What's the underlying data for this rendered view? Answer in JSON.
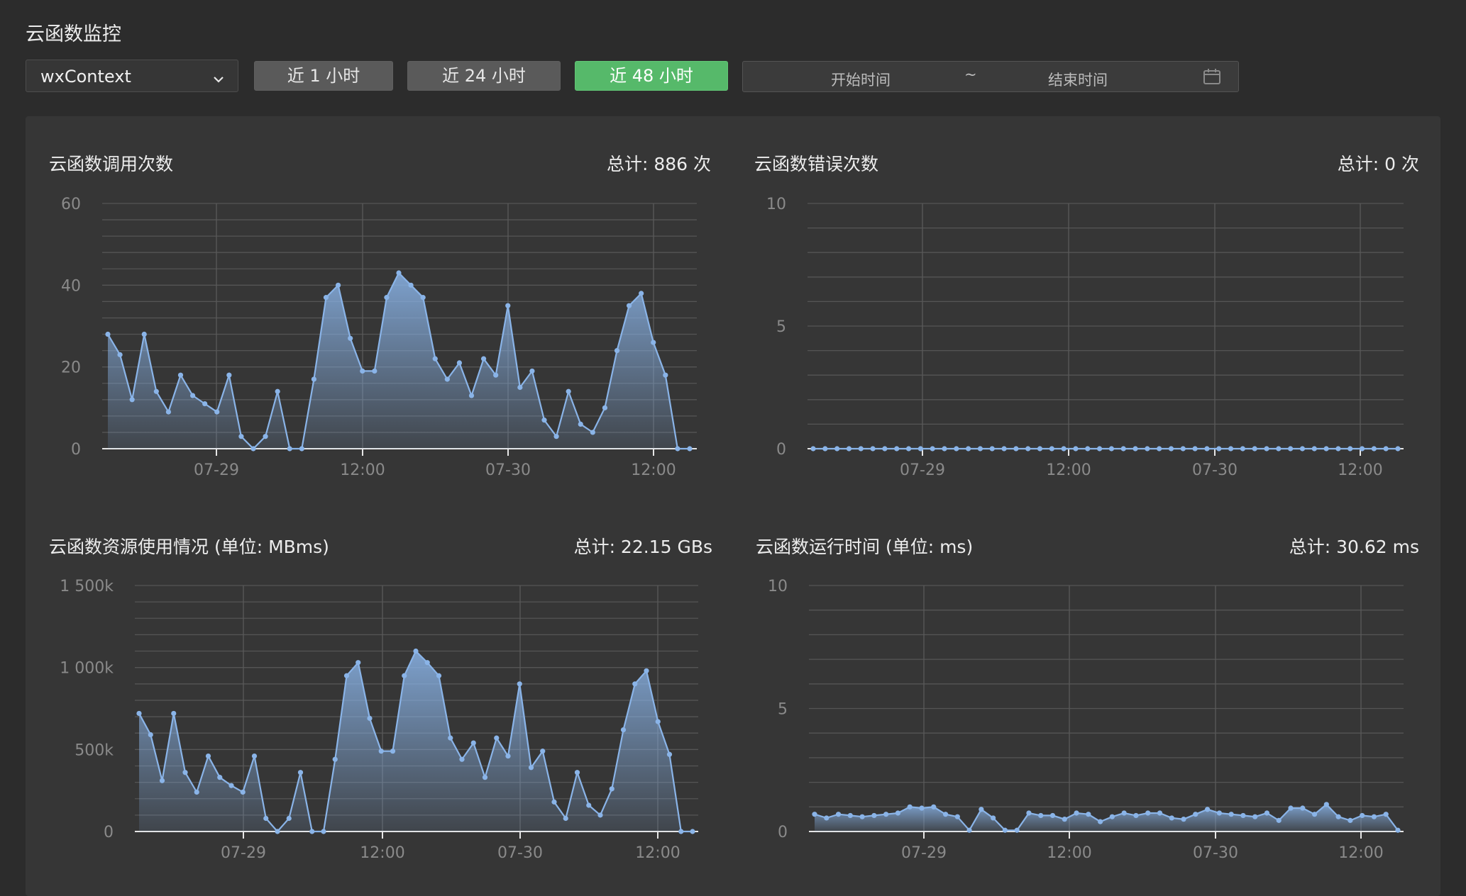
{
  "page": {
    "title": "云函数监控"
  },
  "filters": {
    "function_select": {
      "value": "wxContext"
    },
    "buttons": [
      {
        "label": "近 1 小时",
        "active": false
      },
      {
        "label": "近 24 小时",
        "active": false
      },
      {
        "label": "近 48 小时",
        "active": true
      }
    ],
    "date_range": {
      "start_placeholder": "开始时间",
      "separator": "~",
      "end_placeholder": "结束时间"
    }
  },
  "colors": {
    "accent_green": "#56b96a",
    "series_blue": "#8ab4e8",
    "background": "#2c2c2c",
    "panel": "#363636"
  },
  "icons": {
    "dropdown": "chevron-down-icon",
    "calendar": "calendar-icon"
  },
  "charts": [
    {
      "title": "云函数调用次数",
      "total": "总计: 886 次"
    },
    {
      "title": "云函数错误次数",
      "total": "总计: 0 次"
    },
    {
      "title": "云函数资源使用情况 (单位: MBms)",
      "total": "总计: 22.15 GBs"
    },
    {
      "title": "云函数运行时间 (单位: ms)",
      "total": "总计: 30.62 ms"
    }
  ],
  "chart_data": [
    {
      "type": "area",
      "title": "云函数调用次数",
      "x_tick_labels": [
        "07-29",
        "12:00",
        "07-30",
        "12:00"
      ],
      "y_tick_labels": [
        "0",
        "20",
        "40",
        "60"
      ],
      "ylim": [
        0,
        60
      ],
      "grid": true,
      "values": [
        28,
        23,
        12,
        28,
        14,
        9,
        18,
        13,
        11,
        9,
        18,
        3,
        0,
        3,
        14,
        0,
        0,
        17,
        37,
        40,
        27,
        19,
        19,
        37,
        43,
        40,
        37,
        22,
        17,
        21,
        13,
        22,
        18,
        35,
        15,
        19,
        7,
        3,
        14,
        6,
        4,
        10,
        24,
        35,
        38,
        26,
        18,
        0,
        0
      ]
    },
    {
      "type": "area",
      "title": "云函数错误次数",
      "x_tick_labels": [
        "07-29",
        "12:00",
        "07-30",
        "12:00"
      ],
      "y_tick_labels": [
        "0",
        "5",
        "10"
      ],
      "ylim": [
        0,
        10
      ],
      "grid": true,
      "values": [
        0,
        0,
        0,
        0,
        0,
        0,
        0,
        0,
        0,
        0,
        0,
        0,
        0,
        0,
        0,
        0,
        0,
        0,
        0,
        0,
        0,
        0,
        0,
        0,
        0,
        0,
        0,
        0,
        0,
        0,
        0,
        0,
        0,
        0,
        0,
        0,
        0,
        0,
        0,
        0,
        0,
        0,
        0,
        0,
        0,
        0,
        0,
        0,
        0,
        0
      ]
    },
    {
      "type": "area",
      "title": "云函数资源使用情况 (单位: MBms)",
      "x_tick_labels": [
        "07-29",
        "12:00",
        "07-30",
        "12:00"
      ],
      "y_tick_labels": [
        "0",
        "500k",
        "1 000k",
        "1 500k"
      ],
      "ylim": [
        0,
        1500000
      ],
      "grid": true,
      "values": [
        720000,
        590000,
        310000,
        720000,
        360000,
        240000,
        460000,
        330000,
        280000,
        240000,
        460000,
        80000,
        0,
        80000,
        360000,
        0,
        0,
        440000,
        950000,
        1030000,
        690000,
        490000,
        490000,
        950000,
        1100000,
        1030000,
        950000,
        570000,
        440000,
        540000,
        330000,
        570000,
        460000,
        900000,
        390000,
        490000,
        180000,
        80000,
        360000,
        160000,
        100000,
        260000,
        620000,
        900000,
        980000,
        670000,
        470000,
        0,
        0
      ]
    },
    {
      "type": "area",
      "title": "云函数运行时间 (单位: ms)",
      "x_tick_labels": [
        "07-29",
        "12:00",
        "07-30",
        "12:00"
      ],
      "y_tick_labels": [
        "0",
        "5",
        "10"
      ],
      "ylim": [
        0,
        10
      ],
      "grid": true,
      "values": [
        0.7,
        0.55,
        0.7,
        0.65,
        0.6,
        0.65,
        0.7,
        0.75,
        1.0,
        0.95,
        1.0,
        0.7,
        0.6,
        0.05,
        0.9,
        0.55,
        0.05,
        0.05,
        0.75,
        0.65,
        0.65,
        0.5,
        0.75,
        0.7,
        0.4,
        0.6,
        0.75,
        0.65,
        0.75,
        0.75,
        0.55,
        0.5,
        0.7,
        0.9,
        0.75,
        0.7,
        0.65,
        0.6,
        0.75,
        0.45,
        0.95,
        0.95,
        0.7,
        1.1,
        0.6,
        0.45,
        0.65,
        0.6,
        0.7,
        0.05
      ]
    }
  ]
}
